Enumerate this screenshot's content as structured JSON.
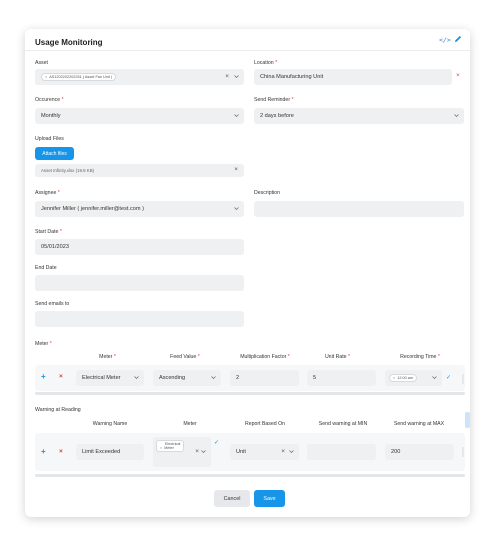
{
  "header": {
    "title": "Usage Monitoring"
  },
  "asset": {
    "label": "Asset",
    "chip": "AS1202202202251 ( Asset Fan Unit )"
  },
  "location": {
    "label": "Location",
    "required": "*",
    "value": "China Manufacturing Unit"
  },
  "occurence": {
    "label": "Occurence",
    "required": "*",
    "value": "Monthly"
  },
  "send_reminder": {
    "label": "Send Reminder",
    "required": "*",
    "value": "2 days before"
  },
  "upload": {
    "label": "Upload Files",
    "button": "Attach files",
    "file": "Asset Infinity.xlsx (19.8 KB)"
  },
  "assignee": {
    "label": "Assignee",
    "required": "*",
    "value": "Jennifer Miller ( jennifer.miller@test.com )"
  },
  "description": {
    "label": "Description",
    "value": ""
  },
  "start_date": {
    "label": "Start Date",
    "required": "*",
    "value": "05/01/2023"
  },
  "end_date": {
    "label": "End Date",
    "value": ""
  },
  "send_emails": {
    "label": "Send emails to",
    "value": ""
  },
  "meter": {
    "label": "Meter",
    "required": "*",
    "columns": [
      "Meter",
      "Feed Value",
      "Multiplication Factor",
      "Unit Rate",
      "Recording Time"
    ],
    "row": {
      "meter": "Electrical Meter",
      "feed_value": "Ascending",
      "multiplication_factor": "2",
      "unit_rate": "5",
      "recording_time": "12:00 am"
    }
  },
  "warning": {
    "label": "Warning at Reading",
    "columns": [
      "Warning Name",
      "Meter",
      "Report Based On",
      "Send warning at MIN",
      "Send warning at MAX"
    ],
    "row": {
      "warning_name": "Limit Exceeded",
      "meter_chip_1": "Electrical",
      "meter_chip_2": "Meter",
      "report_based_on": "Unit",
      "min": "",
      "max": "200"
    }
  },
  "footer": {
    "cancel": "Cancel",
    "save": "Save"
  },
  "colors": {
    "accent": "#1795e8",
    "danger": "#e0393e",
    "field_bg": "#eef0f2"
  },
  "icons": [
    "code-icon",
    "edit-icon",
    "close-icon",
    "chevron-down-icon",
    "plus-icon",
    "minus-icon",
    "check-icon"
  ]
}
